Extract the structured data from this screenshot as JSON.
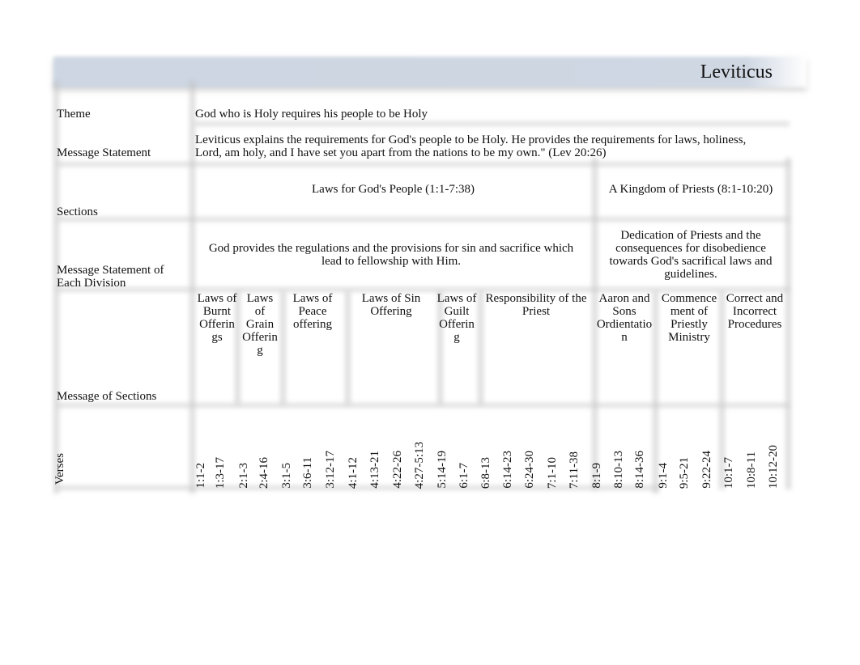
{
  "title": "Leviticus",
  "rows": {
    "theme_label": "Theme",
    "theme_value": "God who is Holy requires his people to be Holy",
    "message_label": "Message Statement",
    "message_line1": "Leviticus explains the requirements for God's people to be Holy. He provides the requirements for laws, holiness,",
    "message_line2": "Lord, am holy, and I have set you apart from the nations to be my own.\" (Lev 20:26)",
    "sections_label": "Sections",
    "division_label_line1": "Message Statement of",
    "division_label_line2": "Each Division",
    "message_sections_label": "Message of Sections",
    "verses_label": "Verses"
  },
  "sections": [
    {
      "title": "Laws for God's People (1:1-7:38)",
      "division_message_lines": [
        "God provides the regulations and the provisions for sin and sacrifice which",
        "lead to fellowship with Him."
      ]
    },
    {
      "title": "A Kingdom of Priests (8:1-10:20)",
      "division_message_lines": [
        "Dedication of Priests and the",
        "consequences for disobedience",
        "towards God's sacrifical laws and",
        "guidelines."
      ]
    }
  ],
  "subsections": [
    {
      "lines": [
        "Laws of",
        "Burnt",
        "Offerin",
        "gs"
      ]
    },
    {
      "lines": [
        "Laws",
        "of",
        "Grain",
        "Offerin",
        "g"
      ]
    },
    {
      "lines": [
        "Laws of",
        "Peace",
        "offering"
      ]
    },
    {
      "lines": [
        "Laws of Sin",
        "Offering"
      ]
    },
    {
      "lines": [
        "Laws of",
        "Guilt",
        "Offerin",
        "g"
      ]
    },
    {
      "lines": [
        "Responsibility of the",
        "Priest"
      ]
    },
    {
      "lines": [
        "Aaron and",
        "Sons",
        "Ordientatio",
        "n"
      ]
    },
    {
      "lines": [
        "Commence",
        "ment of",
        "Priestly",
        "Ministry"
      ]
    },
    {
      "lines": [
        "Correct and",
        "Incorrect",
        "Procedures"
      ]
    }
  ],
  "verses": [
    "1:1-2",
    "1:3-17",
    "2:1-3",
    "2:4-16",
    "3:1-5",
    "3:6-11",
    "3:12-17",
    "4:1-12",
    "4:13-21",
    "4:22-26",
    "4:27-5:13",
    "5:14-19",
    "6:1-7",
    "6:8-13",
    "6:14-23",
    "6:24-30",
    "7:1-10",
    "7:11-38",
    "8:1-9",
    "8:10-13",
    "8:14-36",
    "9:1-4",
    "9:5-21",
    "9:22-24",
    "10:1-7",
    "10:8-11",
    "10:12-20"
  ],
  "colors": {
    "header_band": "#cdd6e2",
    "grid_shadow": "#c8c8c8",
    "text": "#111111"
  }
}
